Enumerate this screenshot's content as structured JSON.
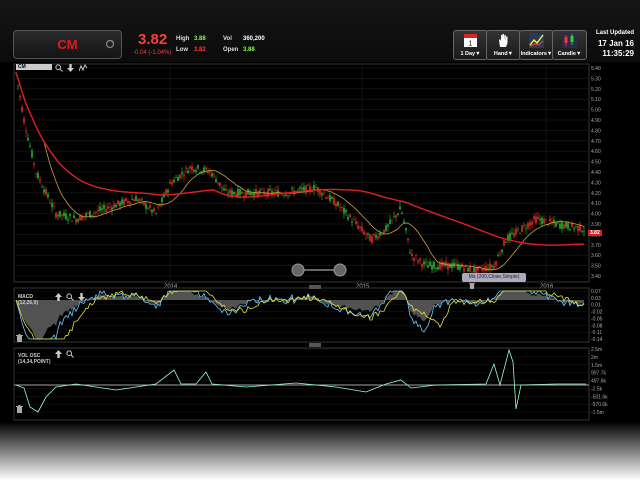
{
  "header": {
    "symbol": "CM",
    "price": "3.82",
    "change": "-0.04 (-1.04%)",
    "high_label": "High",
    "high_value": "3.88",
    "low_label": "Low",
    "low_value": "3.82",
    "vol_label": "Vol",
    "vol_value": "360,200",
    "open_label": "Open",
    "open_value": "3.88",
    "last_updated_label": "Last Updated",
    "last_updated_date": "17 Jan 16",
    "last_updated_time": "11:35:29"
  },
  "toolbar": [
    {
      "label": "1 Day▼",
      "icon": "calendar-icon"
    },
    {
      "label": "Hand▼",
      "icon": "hand-icon"
    },
    {
      "label": "Indicators▼",
      "icon": "indicators-icon"
    },
    {
      "label": "Candle▼",
      "icon": "candle-icon"
    }
  ],
  "calendar_day": "1",
  "colors": {
    "up": "#33cc33",
    "down": "#ff3333",
    "ma_long": "#e02020",
    "ma_short": "#c8a040",
    "macd": "#66ccff",
    "signal": "#e8e040",
    "vol": "#99ffcc"
  },
  "main_panel": {
    "tag": "CM",
    "y_labels": [
      "5.40",
      "5.30",
      "5.20",
      "5.10",
      "5.00",
      "4.90",
      "4.80",
      "4.70",
      "4.60",
      "4.50",
      "4.40",
      "4.30",
      "4.20",
      "4.10",
      "4.00",
      "3.90",
      "3.80",
      "3.70",
      "3.60",
      "3.50",
      "3.40"
    ],
    "x_labels": [
      "2014",
      "2015",
      "2016"
    ],
    "last_price_tag": "3.82",
    "ma_tooltip": "Ma (200,Close,Simple)"
  },
  "macd_panel": {
    "tag": "MACD",
    "params": "(12,26,9)",
    "y_labels": [
      "0.07",
      "0.03",
      "0.01",
      "-0.02",
      "-0.05",
      "-0.08",
      "-0.11",
      "-0.14"
    ]
  },
  "vol_panel": {
    "tag": "VOL OSC",
    "params": "(14,34,POINT)",
    "y_labels": [
      "2.5m",
      "2m",
      "1.5m",
      "997.7k",
      "497.6k",
      "-2.5k",
      "-501.6k",
      "-970.6k",
      "-1.5m"
    ]
  }
}
